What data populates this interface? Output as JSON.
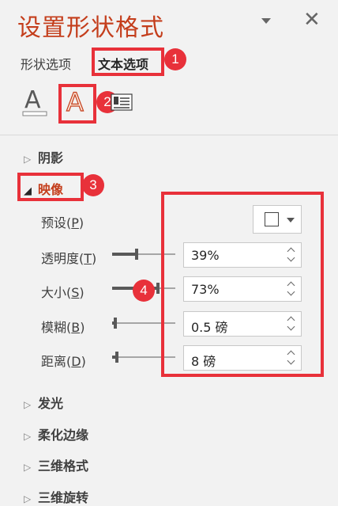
{
  "panel": {
    "title": "设置形状格式",
    "tabs": [
      {
        "label": "形状选项"
      },
      {
        "label": "文本选项"
      }
    ]
  },
  "annotations": [
    "1",
    "2",
    "3",
    "4"
  ],
  "sections": {
    "shadow": "阴影",
    "reflection": "映像",
    "glow": "发光",
    "soft_edges": "柔化边缘",
    "format_3d": "三维格式",
    "rotation_3d": "三维旋转"
  },
  "reflection": {
    "preset": {
      "label": "预设(",
      "key": "P",
      "suffix": ")"
    },
    "transparency": {
      "label": "透明度(",
      "key": "T",
      "suffix": ")",
      "value": "39%",
      "level": 0.39
    },
    "size": {
      "label": "大小(",
      "key": "S",
      "suffix": ")",
      "value": "73%",
      "level": 0.73
    },
    "blur": {
      "label": "模糊(",
      "key": "B",
      "suffix": ")",
      "value": "0.5 磅",
      "level": 0.05
    },
    "distance": {
      "label": "距离(",
      "key": "D",
      "suffix": ")",
      "value": "8 磅",
      "level": 0.08
    }
  },
  "icons": {
    "text_fill": "text-fill-icon",
    "text_outline": "text-outline-icon",
    "text_box": "text-box-icon",
    "collapse": "chevron-down-icon",
    "close": "close-icon"
  },
  "colors": {
    "accent": "#c43e1c",
    "annotation": "#e8313a"
  }
}
